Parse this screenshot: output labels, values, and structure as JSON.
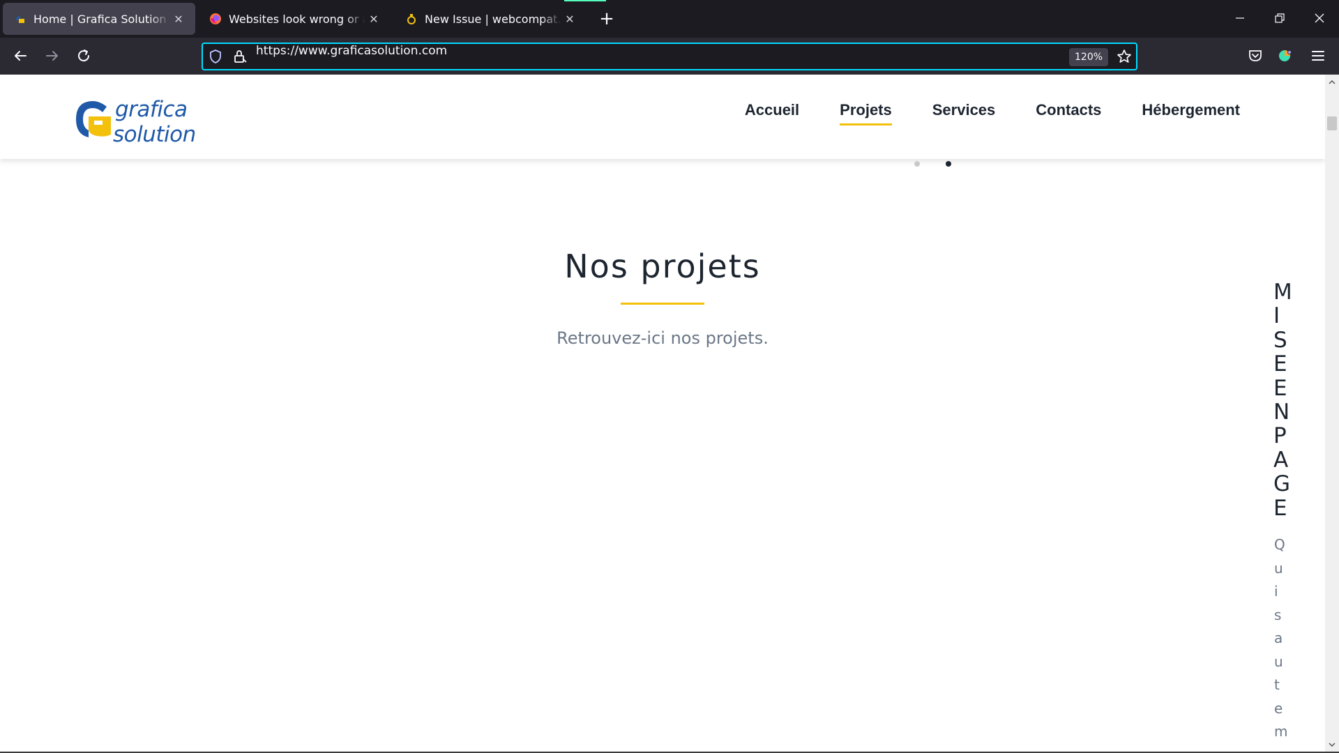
{
  "browser": {
    "tabs": [
      {
        "title": "Home | Grafica Solution",
        "active": true
      },
      {
        "title": "Websites look wrong or appear broken",
        "active": false
      },
      {
        "title": "New Issue | webcompat.com",
        "active": false
      }
    ],
    "url": "https://www.graficasolution.com",
    "zoom": "120%"
  },
  "site": {
    "logo": {
      "line1": "grafica",
      "line2": "solution",
      "colors": {
        "blue": "#1f59a8",
        "yellow": "#f3c10c"
      }
    },
    "nav": [
      {
        "label": "Accueil",
        "active": false
      },
      {
        "label": "Projets",
        "active": true
      },
      {
        "label": "Services",
        "active": false
      },
      {
        "label": "Contacts",
        "active": false
      },
      {
        "label": "Hébergement",
        "active": false
      }
    ],
    "carousel": {
      "slides": 2,
      "active_index": 1
    },
    "section": {
      "title": "Nos projets",
      "subtitle": "Retrouvez-ici nos projets."
    },
    "side_panel": {
      "heading": "MISEENPAGE",
      "text": "Quisautem"
    }
  },
  "colors": {
    "accent": "#f3c10c",
    "url_focus": "#00ddff",
    "tab_indicator": "#54ffbd"
  }
}
